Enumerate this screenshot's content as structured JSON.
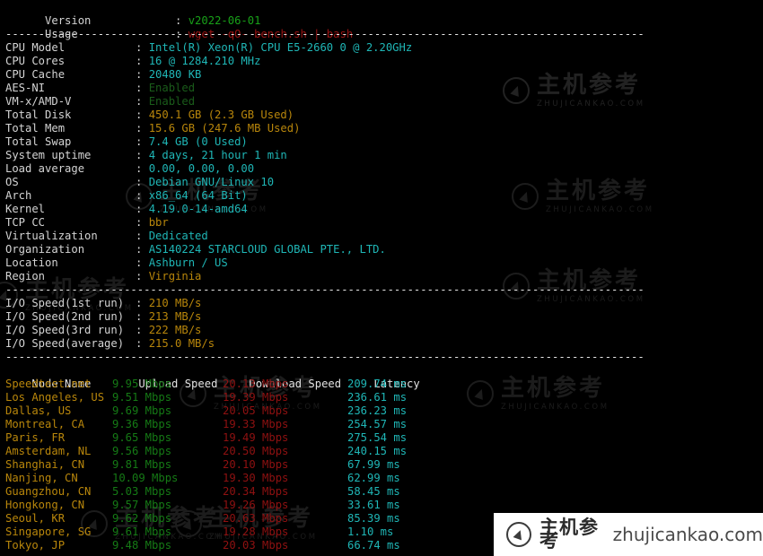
{
  "header": {
    "rows": [
      {
        "label": "Version",
        "value": "v2022-06-01",
        "color": "green"
      },
      {
        "label": "Usage",
        "value": "wget -qO- bench.sh | bash",
        "color": "red"
      }
    ]
  },
  "separator": "-------------------------------------------------------------------------------------------------",
  "sysinfo": [
    {
      "label": "CPU Model",
      "value": "Intel(R) Xeon(R) CPU E5-2660 0 @ 2.20GHz",
      "color": "cyan"
    },
    {
      "label": "CPU Cores",
      "value": "16 @ 1284.210 MHz",
      "color": "cyan"
    },
    {
      "label": "CPU Cache",
      "value": "20480 KB",
      "color": "cyan"
    },
    {
      "label": "AES-NI",
      "value": "Enabled",
      "color": "dimgreen"
    },
    {
      "label": "VM-x/AMD-V",
      "value": "Enabled",
      "color": "dimgreen"
    },
    {
      "label": "Total Disk",
      "value": "450.1 GB (2.3 GB Used)",
      "color": "yellow"
    },
    {
      "label": "Total Mem",
      "value": "15.6 GB (247.6 MB Used)",
      "color": "yellow"
    },
    {
      "label": "Total Swap",
      "value": "7.4 GB (0 Used)",
      "color": "cyan"
    },
    {
      "label": "System uptime",
      "value": "4 days, 21 hour 1 min",
      "color": "cyan"
    },
    {
      "label": "Load average",
      "value": "0.00, 0.00, 0.00",
      "color": "cyan"
    },
    {
      "label": "OS",
      "value": "Debian GNU/Linux 10",
      "color": "cyan"
    },
    {
      "label": "Arch",
      "value": "x86_64 (64 Bit)",
      "color": "cyan"
    },
    {
      "label": "Kernel",
      "value": "4.19.0-14-amd64",
      "color": "cyan"
    },
    {
      "label": "TCP CC",
      "value": "bbr",
      "color": "yellow"
    },
    {
      "label": "Virtualization",
      "value": "Dedicated",
      "color": "cyan"
    },
    {
      "label": "Organization",
      "value": "AS140224 STARCLOUD GLOBAL PTE., LTD.",
      "color": "cyan"
    },
    {
      "label": "Location",
      "value": "Ashburn / US",
      "color": "cyan"
    },
    {
      "label": "Region",
      "value": "Virginia",
      "color": "yellow"
    }
  ],
  "iospeed": [
    {
      "label": "I/O Speed(1st run)",
      "value": "210 MB/s",
      "color": "yellow"
    },
    {
      "label": "I/O Speed(2nd run)",
      "value": "213 MB/s",
      "color": "yellow"
    },
    {
      "label": "I/O Speed(3rd run)",
      "value": "222 MB/s",
      "color": "yellow"
    },
    {
      "label": "I/O Speed(average)",
      "value": "215.0 MB/s",
      "color": "yellow"
    }
  ],
  "speedtest": {
    "headers": {
      "node": "Node Name",
      "upload": "Upload Speed",
      "download": "Download Speed",
      "latency": "Latency"
    },
    "rows": [
      {
        "node": "Speedtest.net",
        "upload": "9.95 Mbps",
        "download": "20.13 Mbps",
        "latency": "209.74 ms"
      },
      {
        "node": "Los Angeles, US",
        "upload": "9.51 Mbps",
        "download": "19.39 Mbps",
        "latency": "236.61 ms"
      },
      {
        "node": "Dallas, US",
        "upload": "9.69 Mbps",
        "download": "20.05 Mbps",
        "latency": "236.23 ms"
      },
      {
        "node": "Montreal, CA",
        "upload": "9.36 Mbps",
        "download": "19.33 Mbps",
        "latency": "254.57 ms"
      },
      {
        "node": "Paris, FR",
        "upload": "9.65 Mbps",
        "download": "19.49 Mbps",
        "latency": "275.54 ms"
      },
      {
        "node": "Amsterdam, NL",
        "upload": "9.56 Mbps",
        "download": "20.50 Mbps",
        "latency": "240.15 ms"
      },
      {
        "node": "Shanghai, CN",
        "upload": "9.81 Mbps",
        "download": "20.10 Mbps",
        "latency": "67.99 ms"
      },
      {
        "node": "Nanjing, CN",
        "upload": "10.09 Mbps",
        "download": "19.30 Mbps",
        "latency": "62.99 ms"
      },
      {
        "node": "Guangzhou, CN",
        "upload": "5.03 Mbps",
        "download": "20.34 Mbps",
        "latency": "58.45 ms"
      },
      {
        "node": "Hongkong, CN",
        "upload": "9.57 Mbps",
        "download": "19.26 Mbps",
        "latency": "33.61 ms"
      },
      {
        "node": "Seoul, KR",
        "upload": "9.62 Mbps",
        "download": "20.63 Mbps",
        "latency": "85.39 ms"
      },
      {
        "node": "Singapore, SG",
        "upload": "9.61 Mbps",
        "download": "19.28 Mbps",
        "latency": "1.10 ms"
      },
      {
        "node": "Tokyo, JP",
        "upload": "9.48 Mbps",
        "download": "20.03 Mbps",
        "latency": "66.74 ms"
      }
    ]
  },
  "watermark": {
    "cn": "主机参考",
    "en": "ZHUJICANKAO.COM",
    "badge_cn": "主机参考",
    "badge_url": "zhujicankao.com"
  },
  "colors": {
    "background": "#000000",
    "label": "#d4d4d4",
    "green": "#18a018",
    "red": "#9c1414",
    "cyan": "#1fb6b6",
    "yellow": "#b8860b",
    "dimgreen": "#1a5c1a",
    "node": "#b8860b",
    "upload": "#157a15",
    "download": "#8f1111",
    "latency": "#1fb6b6"
  }
}
